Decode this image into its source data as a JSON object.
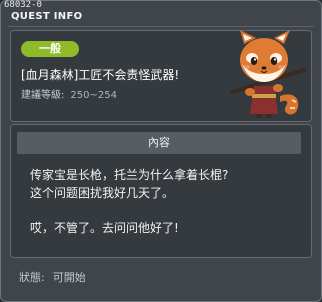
{
  "window": {
    "quest_id": "68032-0",
    "title": "QUEST INFO"
  },
  "summary": {
    "category": "一般",
    "quest_name": "[血月森林]工匠不会责怪武器!",
    "level_label": "建議等級:",
    "level_range": "250~254",
    "npc_icon": "red-panda-npc-portrait"
  },
  "content": {
    "header": "內容",
    "lines": [
      "传家宝是长枪，托兰为什么拿着长棍?",
      "这个问题困扰我好几天了。",
      "哎，不管了。去问问他好了!"
    ]
  },
  "status": {
    "label": "狀態:",
    "value": "可開始"
  },
  "colors": {
    "category_badge": "#8fba2a",
    "panel_bg": "#353a3f",
    "window_bg": "#40454b"
  }
}
